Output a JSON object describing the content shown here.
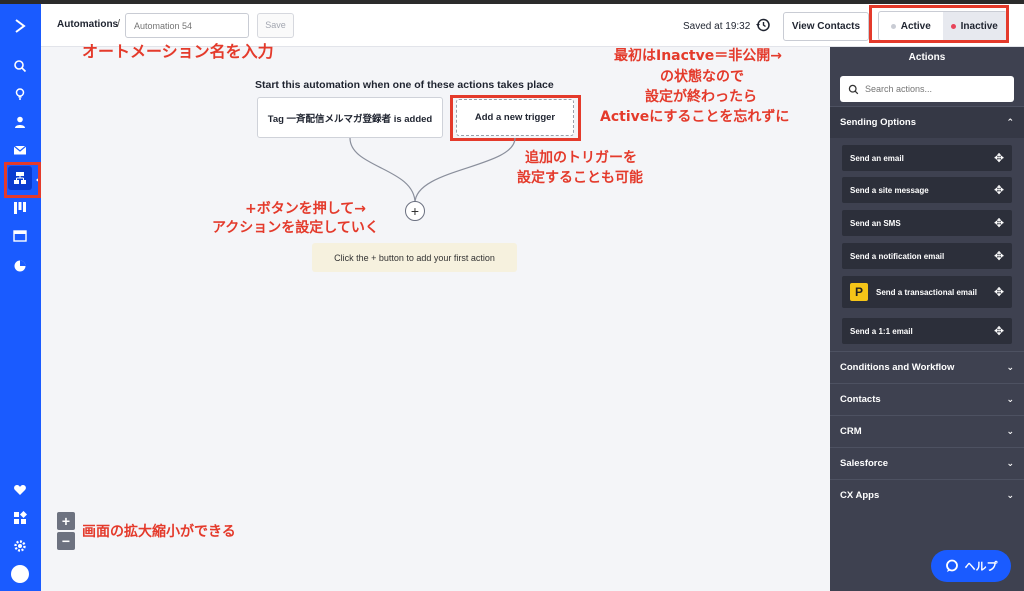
{
  "nav": {
    "items": [
      {
        "name": "search-icon"
      },
      {
        "name": "lightbulb-icon"
      },
      {
        "name": "contacts-icon"
      },
      {
        "name": "email-icon"
      },
      {
        "name": "automations-icon"
      },
      {
        "name": "pipelines-icon"
      },
      {
        "name": "site-icon"
      },
      {
        "name": "reports-icon"
      }
    ],
    "bottom": [
      {
        "name": "heart-icon"
      },
      {
        "name": "apps-icon"
      },
      {
        "name": "settings-icon"
      },
      {
        "name": "avatar"
      }
    ]
  },
  "header": {
    "breadcrumb": "Automations",
    "separator": "/",
    "name_placeholder": "Automation 54",
    "save_label": "Save",
    "saved_text": "Saved at 19:32",
    "view_contacts_label": "View Contacts",
    "active_label": "Active",
    "inactive_label": "Inactive",
    "active_dot_color": "#c9ccd4",
    "inactive_dot_color": "#e8445a"
  },
  "canvas": {
    "title": "Start this automation when one of these actions takes place",
    "trigger_label": "Tag 一斉配信メルマガ登録者 is added",
    "add_trigger_label": "Add a new trigger",
    "plus_label": "+",
    "hint_text": "Click the + button to add your first action",
    "zoom_in": "+",
    "zoom_out": "−"
  },
  "annotations": {
    "name": "オートメーション名を入力",
    "status_line1": "最初はInactve＝非公開→",
    "status_line2": "の状態なので",
    "status_line3": "設定が終わったら",
    "status_line4": "Activeにすることを忘れずに",
    "trigger_line1": "追加のトリガーを",
    "trigger_line2": "設定することも可能",
    "plus_line1": "+ボタンを押して→",
    "plus_line2": "アクションを設定していく",
    "zoom": "画面の拡大縮小ができる"
  },
  "panel": {
    "title": "Actions",
    "search_placeholder": "Search actions...",
    "sections": {
      "sending": "Sending Options",
      "conditions": "Conditions and Workflow",
      "contacts": "Contacts",
      "crm": "CRM",
      "salesforce": "Salesforce",
      "cx": "CX Apps"
    },
    "items": {
      "email": "Send an email",
      "site_message": "Send a site message",
      "sms": "Send an SMS",
      "notification": "Send a notification email",
      "transactional": "Send a transactional email",
      "one_to_one": "Send a 1:1 email"
    },
    "p_logo": "P"
  },
  "help": {
    "label": "ヘルプ"
  }
}
